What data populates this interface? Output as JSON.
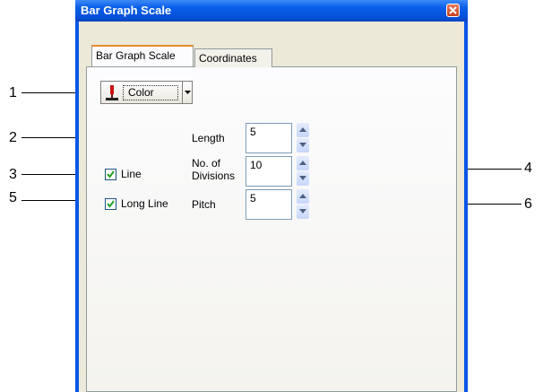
{
  "window": {
    "title": "Bar Graph Scale"
  },
  "tabs": [
    {
      "label": "Bar Graph Scale",
      "active": true
    },
    {
      "label": "Coordinates",
      "active": false
    }
  ],
  "color_button": {
    "label": "Color"
  },
  "length": {
    "label": "Length",
    "value": "5"
  },
  "line": {
    "label": "Line",
    "checked": true
  },
  "divisions": {
    "label_line1": "No. of",
    "label_line2": "Divisions",
    "value": "10"
  },
  "long_line": {
    "label": "Long Line",
    "checked": true
  },
  "pitch": {
    "label": "Pitch",
    "value": "5"
  },
  "callouts": [
    "1",
    "2",
    "3",
    "4",
    "5",
    "6"
  ]
}
